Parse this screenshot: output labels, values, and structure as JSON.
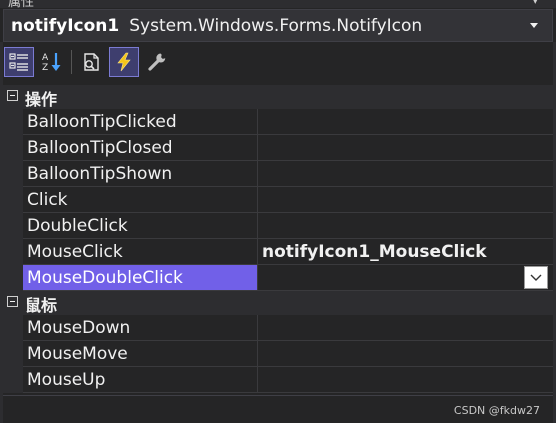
{
  "title_partial": "属性",
  "object_selector": {
    "name": "notifyIcon1",
    "type": "System.Windows.Forms.NotifyIcon"
  },
  "toolbar": {
    "buttons": [
      {
        "name": "categorized",
        "icon": "categorized-icon",
        "active": true
      },
      {
        "name": "alphabetical",
        "icon": "alphabetical-icon",
        "active": false
      },
      {
        "name": "properties",
        "icon": "properties-icon",
        "active": false
      },
      {
        "name": "events",
        "icon": "lightning-icon",
        "active": true
      },
      {
        "name": "property-pages",
        "icon": "wrench-icon",
        "active": false
      }
    ]
  },
  "categories": [
    {
      "label": "操作",
      "items": [
        {
          "name": "BalloonTipClicked",
          "value": ""
        },
        {
          "name": "BalloonTipClosed",
          "value": ""
        },
        {
          "name": "BalloonTipShown",
          "value": ""
        },
        {
          "name": "Click",
          "value": ""
        },
        {
          "name": "DoubleClick",
          "value": ""
        },
        {
          "name": "MouseClick",
          "value": "notifyIcon1_MouseClick"
        },
        {
          "name": "MouseDoubleClick",
          "value": ""
        }
      ]
    },
    {
      "label": "鼠标",
      "items": [
        {
          "name": "MouseDown",
          "value": ""
        },
        {
          "name": "MouseMove",
          "value": ""
        },
        {
          "name": "MouseUp",
          "value": ""
        }
      ]
    }
  ],
  "selected_item": "MouseDoubleClick",
  "watermark": "CSDN @fkdw27",
  "colors": {
    "selection": "#7160e8",
    "background": "#252526",
    "text": "#f1f1f1"
  }
}
